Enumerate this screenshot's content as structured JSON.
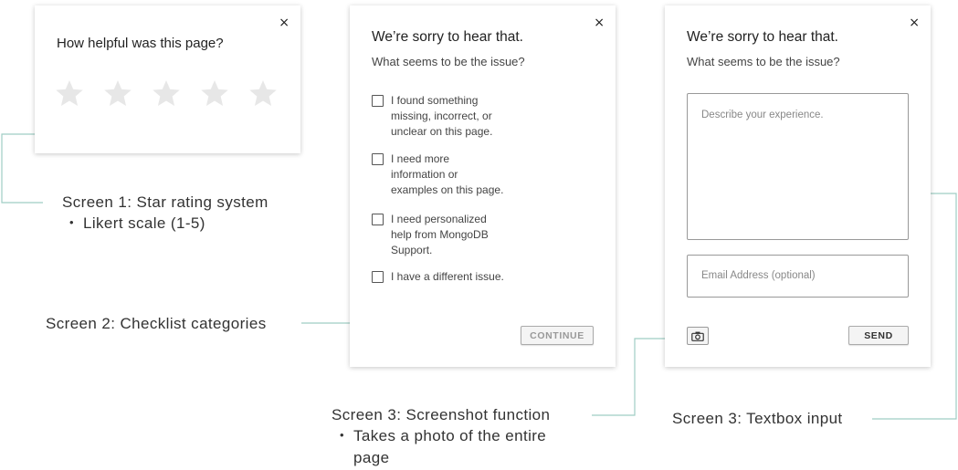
{
  "close_symbol": "×",
  "screen1": {
    "question": "How helpful was this page?",
    "star_count": 5
  },
  "screen2": {
    "title": "We’re sorry to hear that.",
    "subtitle": "What seems to be the issue?",
    "options": [
      {
        "line1": "I found something",
        "line2": "missing, incorrect, or",
        "line3": "unclear on this page."
      },
      {
        "line1": "I need more",
        "line2": "information or",
        "line3": "examples on this page."
      },
      {
        "line1": "I need personalized",
        "line2": "help from MongoDB",
        "line3": "Support."
      },
      {
        "line1": "I have a different issue."
      }
    ],
    "continue_label": "CONTINUE"
  },
  "screen3": {
    "title": "We’re sorry to hear that.",
    "subtitle": "What seems to be the issue?",
    "textarea_placeholder": "Describe your experience.",
    "email_placeholder": "Email Address (optional)",
    "send_label": "SEND"
  },
  "annotations": {
    "screen1_label": "Screen 1: Star rating system",
    "screen1_bullet": "Likert scale (1-5)",
    "screen2_label": "Screen 2: Checklist categories",
    "screen3_screenshot_label": "Screen 3: Screenshot function",
    "screen3_screenshot_bullet": "Takes a photo of the entire page",
    "screen3_textbox_label": "Screen 3: Textbox input",
    "bullet_symbol": "•"
  },
  "colors": {
    "connector": "#9fcdc4",
    "star": "#e7e7e7",
    "button_text_disabled": "#999999",
    "button_text": "#333333"
  },
  "icons": [
    "close-icon",
    "star-icon",
    "checkbox-icon",
    "camera-icon"
  ]
}
